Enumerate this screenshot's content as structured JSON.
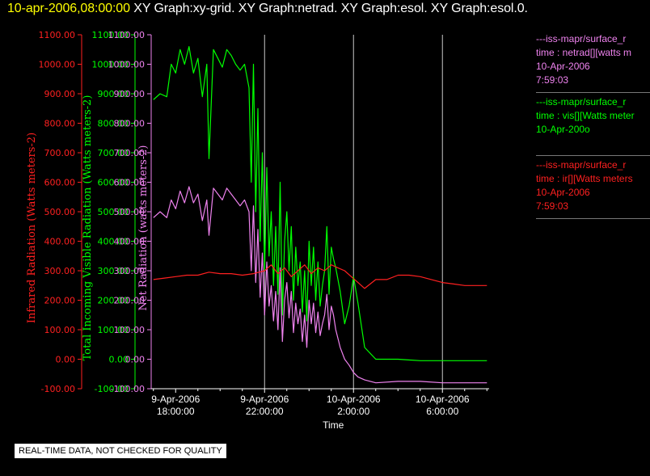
{
  "title": {
    "timestamp": "10-apr-2006,08:00:00",
    "rest": " XY Graph:xy-grid.  XY Graph:netrad.  XY Graph:esol.  XY Graph:esol.0."
  },
  "colors": {
    "ir": "#ff2020",
    "vis": "#00ff00",
    "net": "#ee82ee",
    "axis": "#ffffff",
    "grid": "#c8c8c8"
  },
  "legend": [
    {
      "color": "#ee82ee",
      "lines": [
        "---iss-mapr/surface_r",
        "time : netrad[][watts m",
        "10-Apr-2006",
        "7:59:03"
      ]
    },
    {
      "color": "#00ff00",
      "lines": [
        "---iss-mapr/surface_r",
        "time : vis[][Watts meter",
        "10-Apr-200o",
        ""
      ]
    },
    {
      "color": "#ff2020",
      "lines": [
        "---iss-mapr/surface_r",
        "time : ir[][Watts meters",
        "10-Apr-2006",
        "7:59:03"
      ]
    }
  ],
  "disclaimer": "REAL-TIME DATA, NOT CHECKED FOR QUALITY",
  "chart_data": {
    "type": "line",
    "xlabel": "Time",
    "x_tick_labels": [
      [
        "9-Apr-2006",
        "18:00:00"
      ],
      [
        "9-Apr-2006",
        "22:00:00"
      ],
      [
        "10-Apr-2006",
        "2:00:00"
      ],
      [
        "10-Apr-2006",
        "6:00:00"
      ]
    ],
    "x_ticks_hours": [
      18,
      22,
      26,
      30
    ],
    "xlim_hours": [
      16.9,
      32.1
    ],
    "grid_vertical_hours": [
      22,
      26,
      30
    ],
    "y_axes": [
      {
        "id": "ir",
        "label": "Infrared Radiation (Watts meters-2)",
        "color": "#ff2020",
        "ylim": [
          -100,
          1100
        ],
        "ticks": [
          "-100.00",
          "0.00",
          "100.00",
          "200.00",
          "300.00",
          "400.00",
          "500.00",
          "600.00",
          "700.00",
          "800.00",
          "900.00",
          "1000.00",
          "1100.00"
        ]
      },
      {
        "id": "vis",
        "label": "Total Incoming Visible Radiation (Watts meters-2)",
        "color": "#00ff00",
        "ylim": [
          -100,
          1100
        ],
        "ticks": [
          "-100.00",
          "0.00",
          "100.00",
          "200.00",
          "300.00",
          "400.00",
          "500.00",
          "600.00",
          "700.00",
          "800.00",
          "900.00",
          "1000.00",
          "1100.00"
        ]
      },
      {
        "id": "net",
        "label": "Net Radiation (watts meters-2)",
        "color": "#ee82ee",
        "ylim": [
          -100,
          1100
        ],
        "ticks": [
          "-100.00",
          "0.00",
          "100.00",
          "200.00",
          "300.00",
          "400.00",
          "500.00",
          "600.00",
          "700.00",
          "800.00",
          "900.00",
          "1000.00",
          "1100.00"
        ]
      }
    ],
    "series": [
      {
        "axis": "vis",
        "color": "#00ff00",
        "x": [
          17.0,
          17.3,
          17.6,
          17.8,
          18.0,
          18.2,
          18.4,
          18.6,
          18.8,
          19.0,
          19.2,
          19.4,
          19.5,
          19.7,
          19.9,
          20.1,
          20.3,
          20.5,
          20.7,
          20.9,
          21.1,
          21.3,
          21.4,
          21.5,
          21.6,
          21.7,
          21.8,
          21.9,
          22.0,
          22.1,
          22.2,
          22.3,
          22.4,
          22.5,
          22.6,
          22.7,
          22.8,
          22.9,
          23.0,
          23.1,
          23.2,
          23.3,
          23.4,
          23.5,
          23.6,
          23.7,
          23.8,
          23.9,
          24.0,
          24.1,
          24.2,
          24.3,
          24.4,
          24.5,
          24.6,
          24.7,
          24.8,
          24.9,
          25.0,
          25.1,
          25.2,
          25.4,
          25.6,
          25.8,
          26.0,
          26.2,
          26.5,
          27.0,
          28.0,
          29.0,
          30.0,
          31.0,
          32.0
        ],
        "y": [
          880,
          900,
          890,
          1000,
          970,
          1050,
          1000,
          1060,
          970,
          1020,
          890,
          1000,
          680,
          1050,
          1020,
          990,
          1050,
          1030,
          1000,
          980,
          1000,
          920,
          600,
          1000,
          500,
          850,
          400,
          700,
          300,
          650,
          350,
          500,
          250,
          450,
          220,
          600,
          150,
          400,
          500,
          300,
          450,
          200,
          380,
          250,
          330,
          160,
          300,
          130,
          400,
          250,
          380,
          200,
          330,
          180,
          250,
          300,
          450,
          220,
          380,
          340,
          310,
          230,
          120,
          180,
          280,
          190,
          40,
          0,
          0,
          -5,
          -5,
          -5,
          -5
        ]
      },
      {
        "axis": "net",
        "color": "#ee82ee",
        "x": [
          17.0,
          17.3,
          17.6,
          17.8,
          18.0,
          18.2,
          18.4,
          18.6,
          18.8,
          19.0,
          19.2,
          19.4,
          19.5,
          19.7,
          19.9,
          20.1,
          20.3,
          20.5,
          20.7,
          20.9,
          21.1,
          21.3,
          21.4,
          21.5,
          21.6,
          21.7,
          21.8,
          21.9,
          22.0,
          22.1,
          22.2,
          22.3,
          22.4,
          22.5,
          22.6,
          22.7,
          22.8,
          22.9,
          23.0,
          23.1,
          23.2,
          23.3,
          23.4,
          23.5,
          23.6,
          23.7,
          23.8,
          23.9,
          24.0,
          24.1,
          24.2,
          24.3,
          24.4,
          24.5,
          24.6,
          24.7,
          24.8,
          24.9,
          25.0,
          25.1,
          25.2,
          25.4,
          25.6,
          25.8,
          26.0,
          26.2,
          26.5,
          27.0,
          28.0,
          29.0,
          30.0,
          31.0,
          32.0
        ],
        "y": [
          480,
          500,
          480,
          540,
          510,
          570,
          530,
          585,
          530,
          560,
          470,
          540,
          420,
          580,
          560,
          540,
          580,
          560,
          540,
          520,
          540,
          500,
          300,
          520,
          260,
          440,
          210,
          360,
          150,
          330,
          180,
          250,
          130,
          230,
          100,
          310,
          60,
          200,
          260,
          140,
          230,
          90,
          190,
          120,
          170,
          60,
          150,
          40,
          200,
          120,
          190,
          90,
          160,
          80,
          120,
          150,
          220,
          100,
          180,
          150,
          100,
          40,
          0,
          -20,
          -45,
          -60,
          -70,
          -80,
          -75,
          -75,
          -80,
          -80,
          -80
        ]
      },
      {
        "axis": "ir",
        "color": "#ff2020",
        "x": [
          17.0,
          17.5,
          18.0,
          18.5,
          19.0,
          19.5,
          20.0,
          20.5,
          21.0,
          21.5,
          22.0,
          22.3,
          22.6,
          22.9,
          23.2,
          23.5,
          23.8,
          24.1,
          24.4,
          24.7,
          25.0,
          25.3,
          25.6,
          25.9,
          26.2,
          26.5,
          27.0,
          27.5,
          28.0,
          28.5,
          29.0,
          29.5,
          30.0,
          30.5,
          31.0,
          31.5,
          32.0
        ],
        "y": [
          270,
          275,
          280,
          285,
          285,
          295,
          290,
          290,
          285,
          290,
          300,
          320,
          290,
          310,
          280,
          300,
          320,
          290,
          310,
          300,
          320,
          310,
          300,
          280,
          260,
          240,
          270,
          270,
          285,
          285,
          280,
          270,
          260,
          255,
          250,
          250,
          250
        ]
      }
    ]
  }
}
